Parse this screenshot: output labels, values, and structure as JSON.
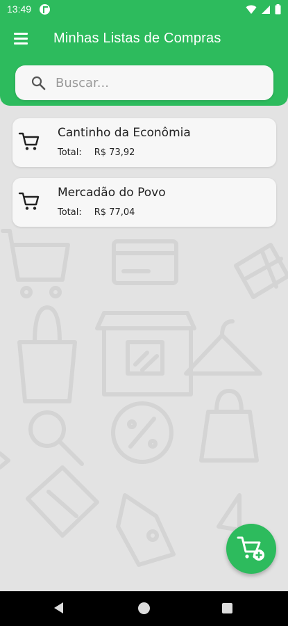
{
  "status_bar": {
    "time": "13:49"
  },
  "app_bar": {
    "title": "Minhas Listas de Compras"
  },
  "search": {
    "placeholder": "Buscar..."
  },
  "lists": [
    {
      "name": "Cantinho da Econômia",
      "total_label": "Total:",
      "total_value": "R$ 73,92"
    },
    {
      "name": "Mercadão do Povo",
      "total_label": "Total:",
      "total_value": "R$ 77,04"
    }
  ],
  "colors": {
    "primary": "#2dbb5d",
    "background": "#e3e3e3",
    "card": "#f7f7f7"
  },
  "icons": {
    "menu": "hamburger-menu-icon",
    "search": "search-icon",
    "cart": "shopping-cart-icon",
    "fab": "add-to-cart-icon"
  }
}
